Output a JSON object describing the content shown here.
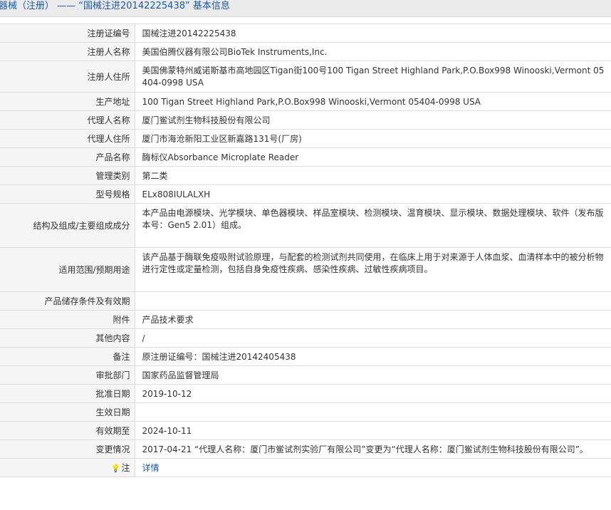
{
  "header": {
    "title": "器械（注册） —— “国械注进20142225438” 基本信息"
  },
  "rows": [
    {
      "label": "注册证编号",
      "value": "国械注进20142225438"
    },
    {
      "label": "注册人名称",
      "value": "美国伯腾仪器有限公司BioTek Instruments,Inc."
    },
    {
      "label": "注册人住所",
      "value": "美国佛蒙特州威诺斯基市高地园区Tigan街100号100 Tigan Street Highland Park,P.O.Box998 Winooski,Vermont 05404-0998 USA"
    },
    {
      "label": "生产地址",
      "value": "100 Tigan Street Highland Park,P.O.Box998 Winooski,Vermont 05404-0998 USA"
    },
    {
      "label": "代理人名称",
      "value": "厦门鲎试剂生物科技股份有限公司"
    },
    {
      "label": "代理人住所",
      "value": "厦门市海沧新阳工业区新嘉路131号(厂房)"
    },
    {
      "label": "产品名称",
      "value": "酶标仪Absorbance Microplate Reader"
    },
    {
      "label": "管理类别",
      "value": "第二类"
    },
    {
      "label": "型号规格",
      "value": "ELx808IULALXH"
    },
    {
      "label": "结构及组成/主要组成成分",
      "value": "本产品由电源模块、光学模块、单色器模块、样品室模块、检测模块、温育模块、显示模块、数据处理模块、软件（发布版本号：Gen5 2.01）组成。"
    },
    {
      "label": "适用范围/预期用途",
      "value": "该产品基于酶联免疫吸附试验原理，与配套的检测试剂共同使用，在临床上用于对来源于人体血浆、血清样本中的被分析物进行定性或定量检测，包括自身免疫性疾病、感染性疾病、过敏性疾病项目。"
    },
    {
      "label": "产品储存条件及有效期",
      "value": ""
    },
    {
      "label": "附件",
      "value": "产品技术要求"
    },
    {
      "label": "其他内容",
      "value": "/"
    },
    {
      "label": "备注",
      "value": "原注册证编号：国械注进20142405438"
    },
    {
      "label": "审批部门",
      "value": "国家药品监督管理局"
    },
    {
      "label": "批准日期",
      "value": "2019-10-12"
    },
    {
      "label": "生效日期",
      "value": ""
    },
    {
      "label": "有效期至",
      "value": "2024-10-11"
    },
    {
      "label": "变更情况",
      "value": "2017-04-21 “代理人名称：厦门市鲎试剂实验厂有限公司”变更为“代理人名称：厦门鲎试剂生物科技股份有限公司”。"
    }
  ],
  "note_row": {
    "icon": "lightbulb-icon",
    "label": "注",
    "link_text": "详情"
  },
  "colors": {
    "title_text": "#1a5aa6",
    "title_bg": "#ebebeb",
    "label_bg": "#f5f5f5",
    "border": "#dddddd",
    "link": "#1a5aa6"
  }
}
